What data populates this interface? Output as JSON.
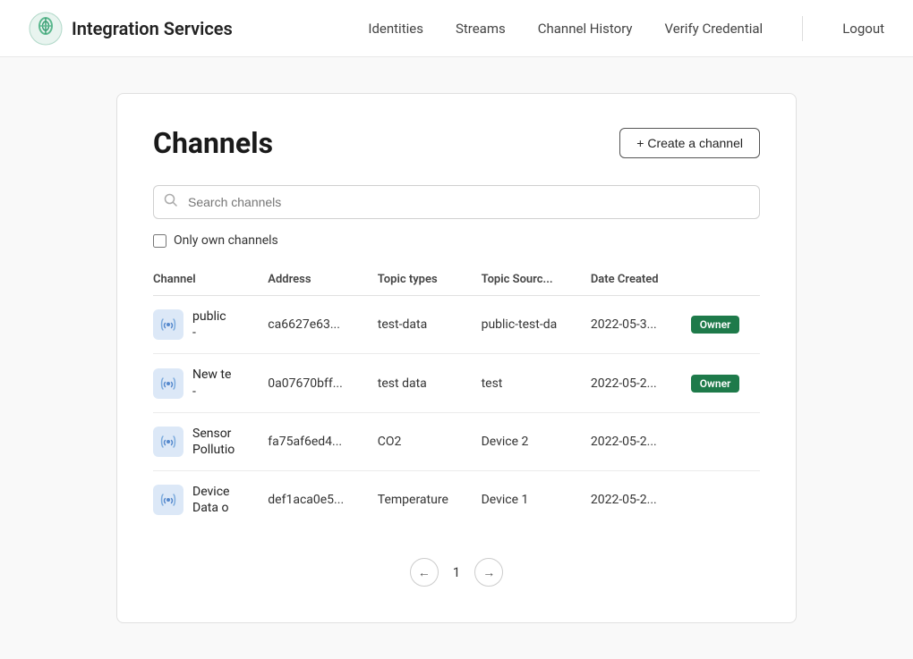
{
  "brand": {
    "name": "Integration Services"
  },
  "nav": {
    "links": [
      {
        "label": "Identities",
        "key": "identities"
      },
      {
        "label": "Streams",
        "key": "streams"
      },
      {
        "label": "Channel History",
        "key": "channel-history"
      },
      {
        "label": "Verify Credential",
        "key": "verify-credential"
      }
    ],
    "logout": "Logout"
  },
  "page": {
    "title": "Channels",
    "create_button": "+ Create a channel"
  },
  "search": {
    "placeholder": "Search channels"
  },
  "filter": {
    "own_channels_label": "Only own channels"
  },
  "table": {
    "headers": [
      "Channel",
      "Address",
      "Topic types",
      "Topic Sourc...",
      "Date Created"
    ],
    "rows": [
      {
        "icon": "wireless",
        "name": "public\n-",
        "address": "ca6627e63...",
        "topic_types": "test-data",
        "topic_source": "public-test-da",
        "date_created": "2022-05-3...",
        "badge": "Owner"
      },
      {
        "icon": "wireless",
        "name": "New te\n-",
        "address": "0a07670bff...",
        "topic_types": "test data",
        "topic_source": "test",
        "date_created": "2022-05-2...",
        "badge": "Owner"
      },
      {
        "icon": "wireless",
        "name": "Sensor\nPollutio",
        "address": "fa75af6ed4...",
        "topic_types": "CO2",
        "topic_source": "Device 2",
        "date_created": "2022-05-2...",
        "badge": null
      },
      {
        "icon": "wireless",
        "name": "Device\nData o",
        "address": "def1aca0e5...",
        "topic_types": "Temperature",
        "topic_source": "Device 1",
        "date_created": "2022-05-2...",
        "badge": null
      }
    ]
  },
  "pagination": {
    "current_page": "1",
    "prev_icon": "←",
    "next_icon": "→"
  }
}
